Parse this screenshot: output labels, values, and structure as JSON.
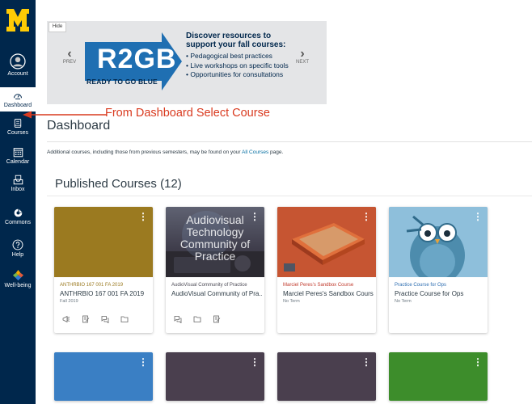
{
  "global_nav": {
    "items": [
      {
        "label": "Account",
        "icon": "account-icon"
      },
      {
        "label": "Dashboard",
        "icon": "dashboard-icon",
        "active": true
      },
      {
        "label": "Courses",
        "icon": "courses-icon"
      },
      {
        "label": "Calendar",
        "icon": "calendar-icon"
      },
      {
        "label": "Inbox",
        "icon": "inbox-icon"
      },
      {
        "label": "Commons",
        "icon": "commons-icon"
      },
      {
        "label": "Help",
        "icon": "help-icon"
      },
      {
        "label": "Well-being",
        "icon": "well-being-icon"
      }
    ],
    "colors": {
      "bg": "#00274c",
      "maize": "#ffcb05"
    }
  },
  "banner": {
    "hide_label": "Hide",
    "prev_label": "PREV",
    "next_label": "NEXT",
    "logo_text": "R2GB",
    "logo_tagline": "READY TO GO BLUE",
    "headline": "Discover resources to support your fall courses:",
    "bullets": [
      "Pedagogical best practices",
      "Live workshops on specific tools",
      "Opportunities for consultations"
    ]
  },
  "annotation": {
    "text": "From Dashboard Select Course",
    "color": "#d93a1f"
  },
  "page": {
    "title": "Dashboard",
    "note_prefix": "Additional courses, including those from previous semesters, may be found on your ",
    "note_link": "All Courses",
    "note_suffix": " page.",
    "section_title": "Published Courses (12)"
  },
  "cards": [
    {
      "short": "ANTHRBIO 167 001 FA 2019",
      "name": "ANTHRBIO 167 001 FA 2019",
      "term": "Fall 2019",
      "color": "#9b7a20",
      "short_color": "#9b7a20",
      "hero": "solid"
    },
    {
      "short": "AudioVisual Community of Practice",
      "name": "AudioVisual Community of Pra...",
      "term": "",
      "color": "#4b4a55",
      "short_color": "#4b4a55",
      "hero": "audiovisual",
      "hero_text": "Audiovisual Technology Community of Practice"
    },
    {
      "short": "Marciel Peres's Sandbox Course",
      "name": "Marciel Peres's Sandbox Course",
      "term": "No Term",
      "color": "#c44a2a",
      "short_color": "#c0392b",
      "hero": "sandbox"
    },
    {
      "short": "Practice Course for Ops",
      "name": "Practice Course for Ops",
      "term": "No Term",
      "color": "#7fb3d5",
      "short_color": "#2b6cb0",
      "hero": "owl"
    }
  ],
  "bottom_cards": [
    {
      "color": "#3a7fc4"
    },
    {
      "color": "#4a3f4e"
    },
    {
      "color": "#4a3f4e"
    },
    {
      "color": "#3d8d2b"
    }
  ]
}
